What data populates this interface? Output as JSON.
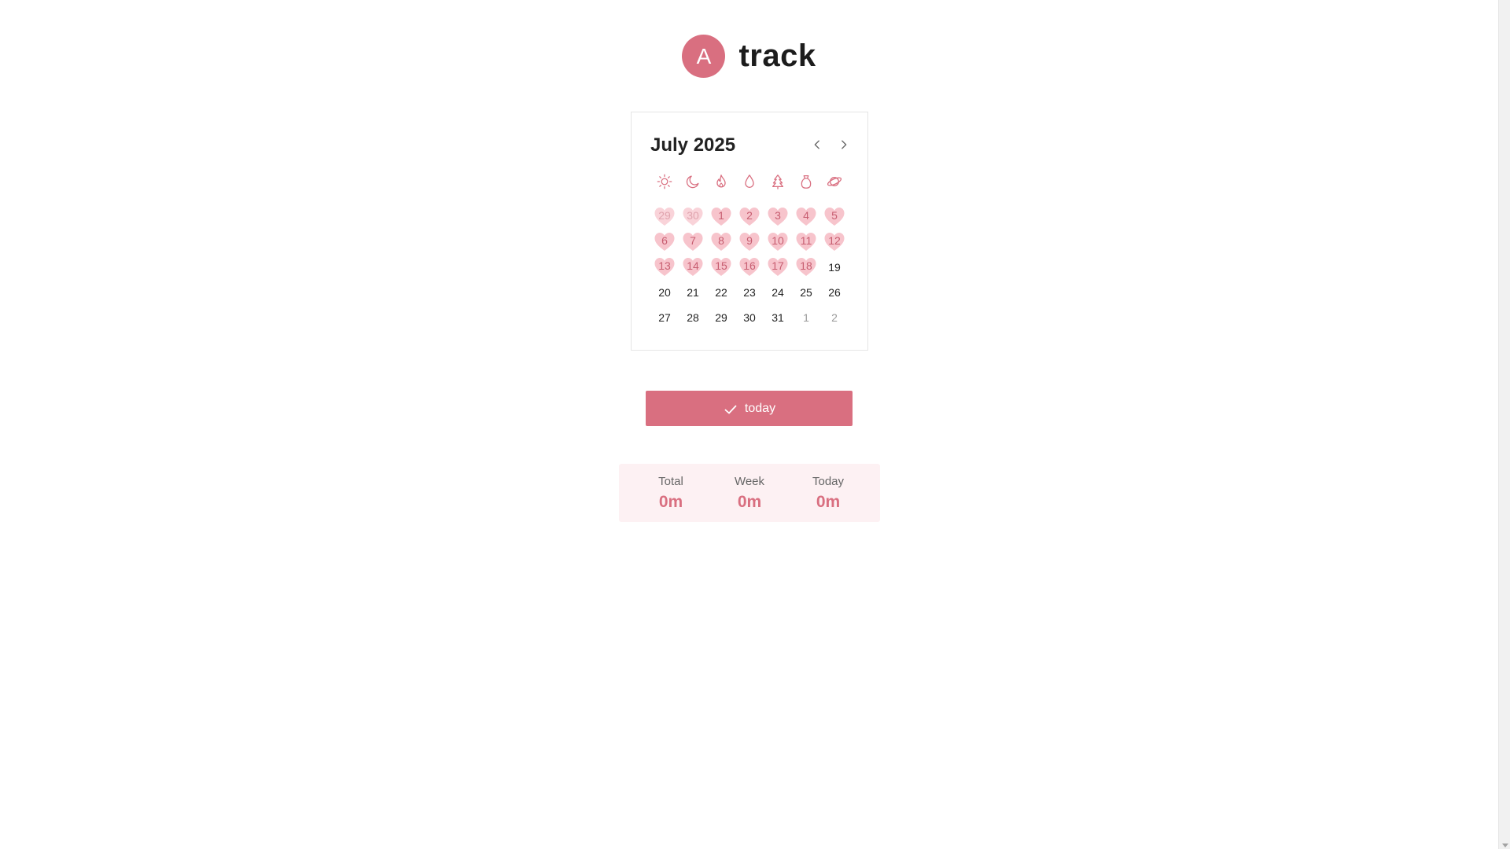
{
  "header": {
    "avatar_letter": "A",
    "title": "track"
  },
  "colors": {
    "accent": "#d96f80",
    "heart_fill": "#f7c4cc",
    "stats_bg": "#fdf1f3"
  },
  "calendar": {
    "month_label": "July 2025",
    "weekday_icons": [
      "sun-icon",
      "moon-icon",
      "flame-icon",
      "droplet-icon",
      "tree-icon",
      "pouch-icon",
      "planet-icon"
    ],
    "weeks": [
      [
        {
          "day": "29",
          "outside": true,
          "marked": true
        },
        {
          "day": "30",
          "outside": true,
          "marked": true
        },
        {
          "day": "1",
          "outside": false,
          "marked": true
        },
        {
          "day": "2",
          "outside": false,
          "marked": true
        },
        {
          "day": "3",
          "outside": false,
          "marked": true
        },
        {
          "day": "4",
          "outside": false,
          "marked": true
        },
        {
          "day": "5",
          "outside": false,
          "marked": true
        }
      ],
      [
        {
          "day": "6",
          "outside": false,
          "marked": true
        },
        {
          "day": "7",
          "outside": false,
          "marked": true
        },
        {
          "day": "8",
          "outside": false,
          "marked": true
        },
        {
          "day": "9",
          "outside": false,
          "marked": true
        },
        {
          "day": "10",
          "outside": false,
          "marked": true
        },
        {
          "day": "11",
          "outside": false,
          "marked": true
        },
        {
          "day": "12",
          "outside": false,
          "marked": true
        }
      ],
      [
        {
          "day": "13",
          "outside": false,
          "marked": true
        },
        {
          "day": "14",
          "outside": false,
          "marked": true
        },
        {
          "day": "15",
          "outside": false,
          "marked": true
        },
        {
          "day": "16",
          "outside": false,
          "marked": true
        },
        {
          "day": "17",
          "outside": false,
          "marked": true
        },
        {
          "day": "18",
          "outside": false,
          "marked": true
        },
        {
          "day": "19",
          "outside": false,
          "marked": false
        }
      ],
      [
        {
          "day": "20",
          "outside": false,
          "marked": false
        },
        {
          "day": "21",
          "outside": false,
          "marked": false
        },
        {
          "day": "22",
          "outside": false,
          "marked": false
        },
        {
          "day": "23",
          "outside": false,
          "marked": false
        },
        {
          "day": "24",
          "outside": false,
          "marked": false
        },
        {
          "day": "25",
          "outside": false,
          "marked": false
        },
        {
          "day": "26",
          "outside": false,
          "marked": false
        }
      ],
      [
        {
          "day": "27",
          "outside": false,
          "marked": false
        },
        {
          "day": "28",
          "outside": false,
          "marked": false
        },
        {
          "day": "29",
          "outside": false,
          "marked": false
        },
        {
          "day": "30",
          "outside": false,
          "marked": false
        },
        {
          "day": "31",
          "outside": false,
          "marked": false
        },
        {
          "day": "1",
          "outside": true,
          "marked": false
        },
        {
          "day": "2",
          "outside": true,
          "marked": false
        }
      ]
    ]
  },
  "today_button": {
    "label": "today",
    "icon": "check-icon"
  },
  "stats": [
    {
      "label": "Total",
      "value": "0m"
    },
    {
      "label": "Week",
      "value": "0m"
    },
    {
      "label": "Today",
      "value": "0m"
    }
  ]
}
